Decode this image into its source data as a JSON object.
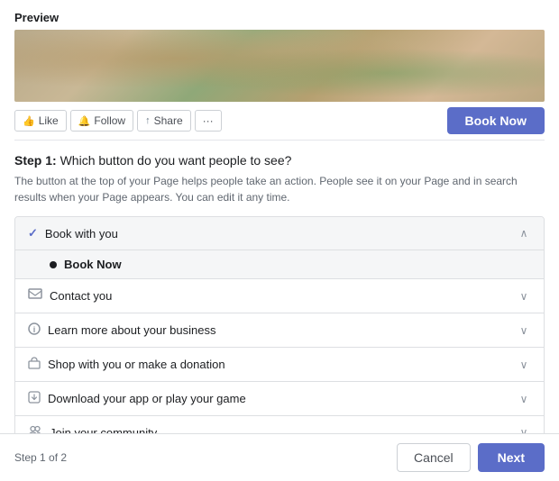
{
  "preview": {
    "label": "Preview",
    "social_buttons": [
      {
        "id": "like",
        "icon": "👍",
        "label": "Like"
      },
      {
        "id": "follow",
        "icon": "🔔",
        "label": "Follow"
      },
      {
        "id": "share",
        "icon": "↑",
        "label": "Share"
      },
      {
        "id": "more",
        "icon": "···",
        "label": ""
      }
    ],
    "book_now_label": "Book Now"
  },
  "step": {
    "number": "Step 1:",
    "title": "Which button do you want people to see?",
    "description": "The button at the top of your Page helps people take an action. People see it on your Page and in search results when your Page appears. You can edit it any time."
  },
  "accordion": {
    "groups": [
      {
        "id": "book-with-you",
        "label": "Book with you",
        "icon": "check",
        "expanded": true,
        "chevron": "up",
        "sub_items": [
          {
            "id": "book-now",
            "label": "Book Now",
            "dot": true
          }
        ]
      },
      {
        "id": "contact-you",
        "label": "Contact you",
        "icon": "box",
        "expanded": false,
        "chevron": "down",
        "sub_items": []
      },
      {
        "id": "learn-more",
        "label": "Learn more about your business",
        "icon": "circle",
        "expanded": false,
        "chevron": "down",
        "sub_items": []
      },
      {
        "id": "shop",
        "label": "Shop with you or make a donation",
        "icon": "bag",
        "expanded": false,
        "chevron": "down",
        "sub_items": []
      },
      {
        "id": "download",
        "label": "Download your app or play your game",
        "icon": "download",
        "expanded": false,
        "chevron": "down",
        "sub_items": []
      },
      {
        "id": "community",
        "label": "Join your community",
        "icon": "people",
        "expanded": false,
        "chevron": "down",
        "sub_items": []
      }
    ]
  },
  "footer": {
    "step_indicator": "Step 1 of 2",
    "cancel_label": "Cancel",
    "next_label": "Next"
  }
}
